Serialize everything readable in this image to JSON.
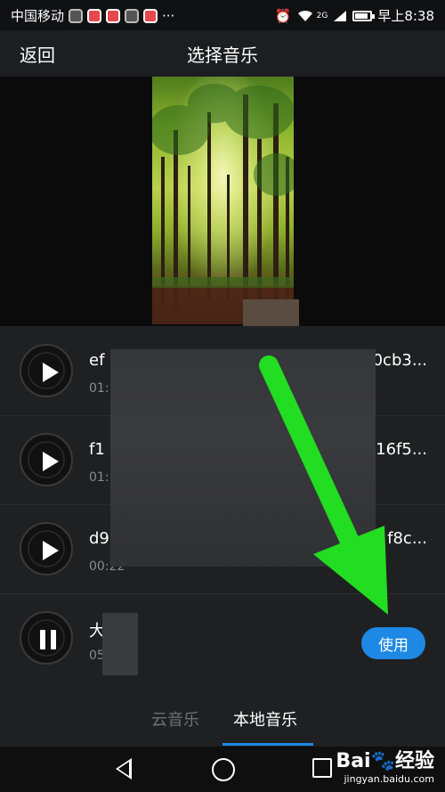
{
  "status_bar": {
    "carrier": "中国移动",
    "network_badge": "2G",
    "time": "早上8:38",
    "icons": [
      "notification-icon",
      "app-icon",
      "app-icon",
      "chat-icon",
      "app-icon",
      "more-icon",
      "alarm-icon",
      "wifi-icon",
      "signal-icon",
      "battery-icon"
    ]
  },
  "header": {
    "back_label": "返回",
    "title": "选择音乐"
  },
  "songs": [
    {
      "name_start": "ef",
      "name_end": "0cb3...",
      "duration": "01:",
      "state": "play"
    },
    {
      "name_start": "f1",
      "name_end": "16f5...",
      "duration": "01:",
      "state": "play"
    },
    {
      "name_start": "d9",
      "name_end": "f8c...",
      "duration": "00:22",
      "state": "play"
    },
    {
      "name_start": "大",
      "name_end": "",
      "duration": "05",
      "state": "pause"
    }
  ],
  "use_button": "使用",
  "tabs": {
    "cloud": "云音乐",
    "local": "本地音乐",
    "active": "local"
  },
  "watermark": {
    "brand": "Bai",
    "brand_cn": "经验",
    "url": "jingyan.baidu.com"
  },
  "colors": {
    "accent": "#1e88e5",
    "arrow": "#22dd22"
  }
}
